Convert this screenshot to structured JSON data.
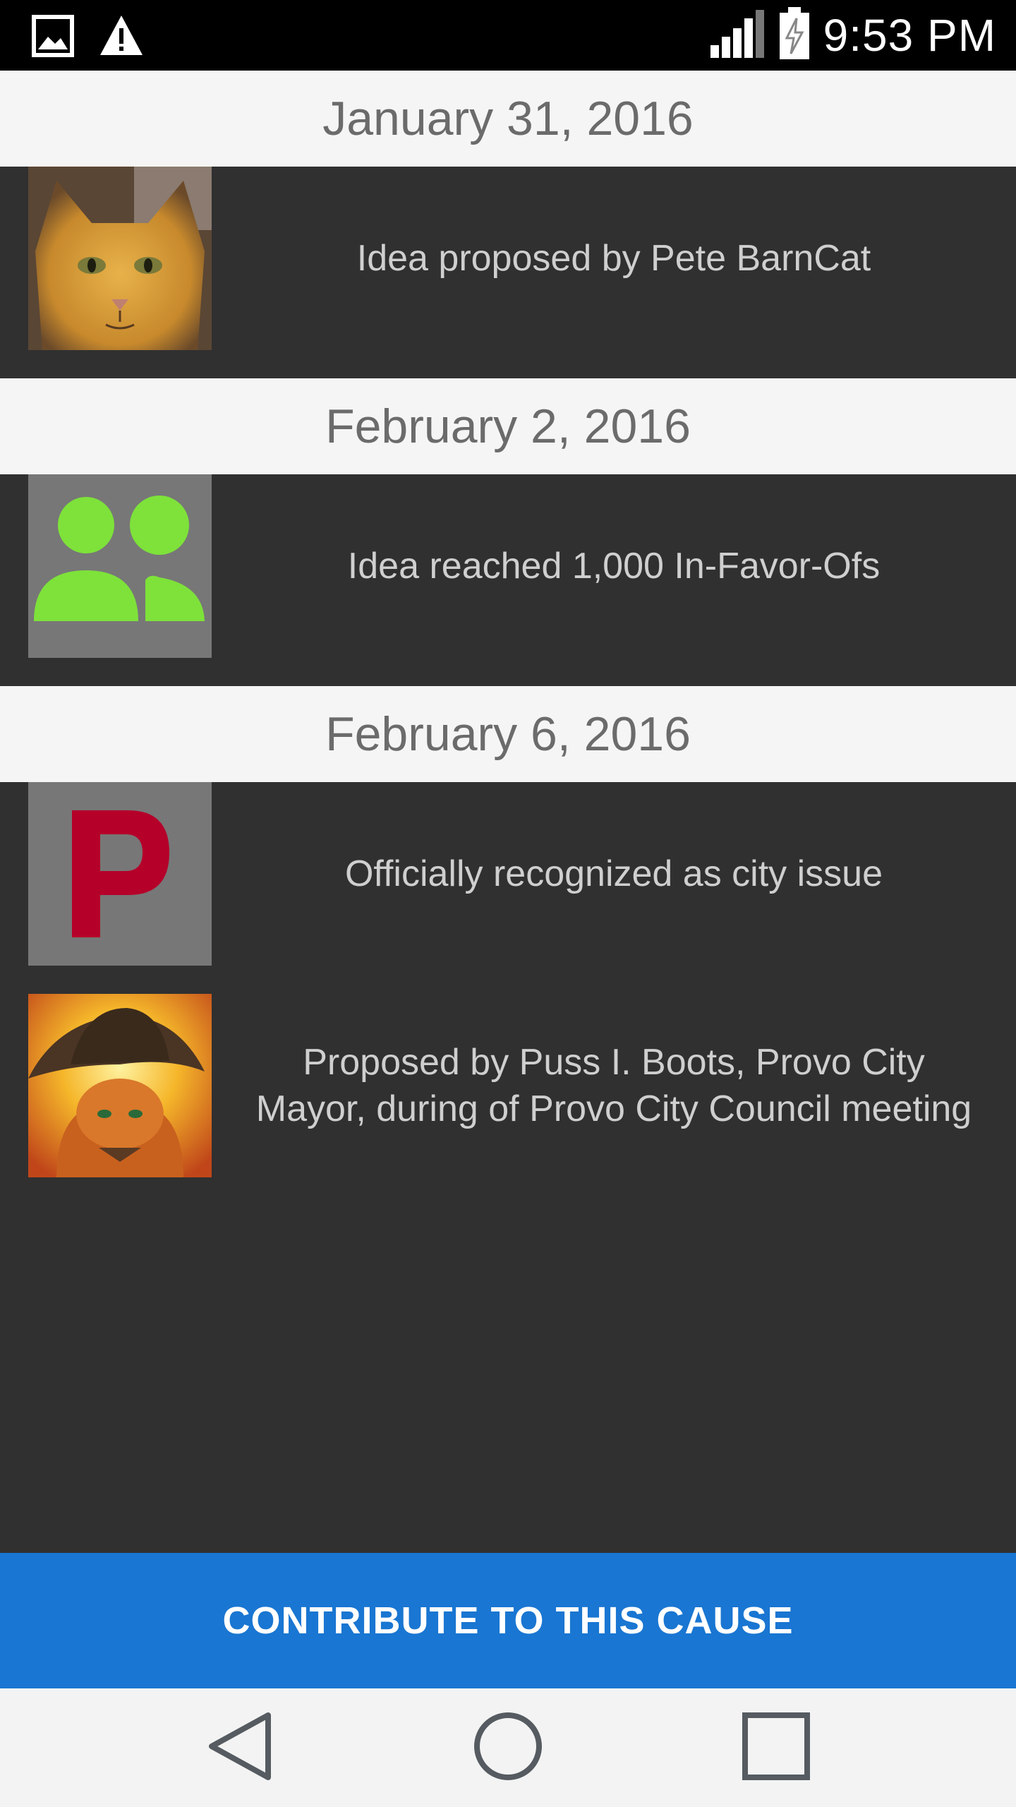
{
  "status_bar": {
    "time": "9:53 PM",
    "icons": [
      "image-icon",
      "warning-icon",
      "signal-icon",
      "battery-charging-icon"
    ]
  },
  "timeline": [
    {
      "date": "January 31, 2016",
      "events": [
        {
          "icon": "orange-cat-avatar",
          "text": "Idea proposed by Pete BarnCat"
        }
      ]
    },
    {
      "date": "February 2, 2016",
      "events": [
        {
          "icon": "people-group-icon",
          "text": "Idea reached 1,000 In-Favor-Ofs"
        }
      ]
    },
    {
      "date": "February 6, 2016",
      "events": [
        {
          "icon": "city-p-logo",
          "text": "Officially recognized as city issue"
        },
        {
          "icon": "puss-in-boots-avatar",
          "text": "Proposed by Puss I. Boots, Provo City Mayor, during of Provo City Council meeting"
        }
      ]
    }
  ],
  "contribute_button": {
    "label": "CONTRIBUTE TO THIS CAUSE",
    "color": "#1976d2"
  },
  "nav_bar": {
    "icons": [
      "back-icon",
      "home-icon",
      "recents-icon"
    ]
  },
  "colors": {
    "background": "#303030",
    "date_header_bg": "#f5f5f5",
    "people_icon_green": "#7ee23a",
    "logo_red": "#b5002a"
  }
}
